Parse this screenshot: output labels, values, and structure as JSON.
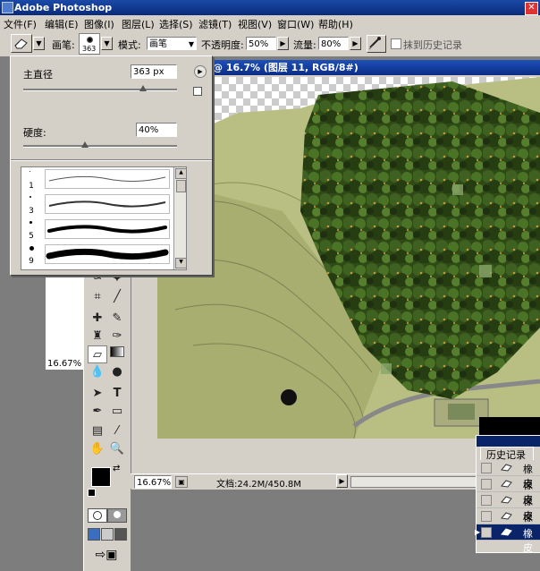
{
  "app": {
    "title": "Adobe Photoshop"
  },
  "menu": [
    "文件(F)",
    "编辑(E)",
    "图像(I)",
    "图层(L)",
    "选择(S)",
    "滤镜(T)",
    "视图(V)",
    "窗口(W)",
    "帮助(H)"
  ],
  "options": {
    "brush_label": "画笔:",
    "brush_size": "363",
    "mode_label": "模式:",
    "mode_value": "画笔",
    "opacity_label": "不透明度:",
    "opacity_value": "50%",
    "flow_label": "流量:",
    "flow_value": "80%",
    "erase_history_label": "抹到历史记录"
  },
  "brush_panel": {
    "diameter_label": "主直径",
    "diameter_value": "363 px",
    "diameter_level": 0.78,
    "hardness_label": "硬度:",
    "hardness_value": "40%",
    "hardness_level": 0.4,
    "presets": [
      {
        "size": "1"
      },
      {
        "size": "3"
      },
      {
        "size": "5"
      },
      {
        "size": "9"
      }
    ]
  },
  "document": {
    "title": "@ 16.7% (图层 11, RGB/8#)",
    "zoom": "16.67%",
    "doc_info": "文档:24.2M/450.8M"
  },
  "navigator": {
    "zoom": "16.67%"
  },
  "history": {
    "title": "历史记录",
    "items": [
      "橡皮",
      "橡皮",
      "橡皮",
      "橡皮",
      "橡皮"
    ]
  },
  "colors": {
    "accent": "#0a246a",
    "panel": "#d4d0c8"
  },
  "icons": [
    "eraser-icon",
    "lasso-icon",
    "crop-icon",
    "healing-brush-icon",
    "brush-icon",
    "stamp-icon",
    "history-brush-icon",
    "gradient-icon",
    "blur-icon",
    "dodge-icon",
    "path-select-icon",
    "type-icon",
    "pen-icon",
    "shape-icon",
    "notes-icon",
    "eyedropper-icon",
    "hand-icon",
    "zoom-icon",
    "swap-colors-icon",
    "quick-mask-icon",
    "screen-mode-icon",
    "jump-to-imageready-icon"
  ]
}
